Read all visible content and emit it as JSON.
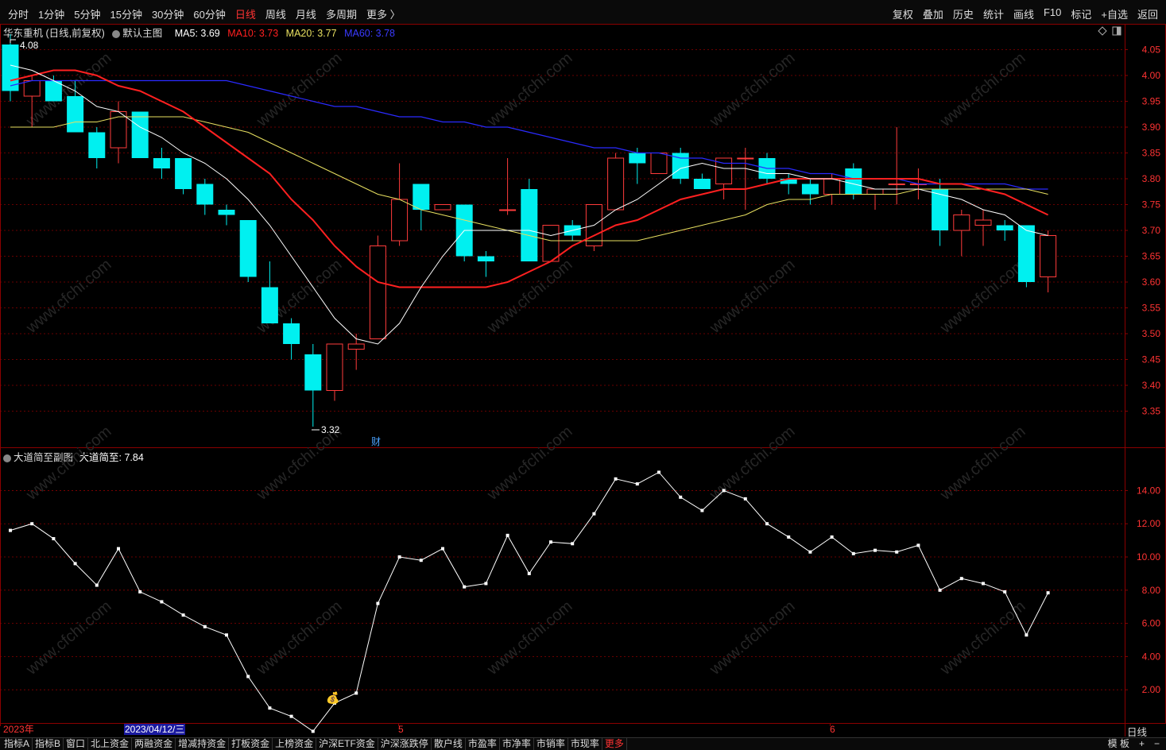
{
  "toolbar": {
    "periods": [
      "分时",
      "1分钟",
      "5分钟",
      "15分钟",
      "30分钟",
      "60分钟",
      "日线",
      "周线",
      "月线",
      "多周期",
      "更多 〉"
    ],
    "active_period": "日线",
    "right_items": [
      "复权",
      "叠加",
      "历史",
      "统计",
      "画线",
      "F10",
      "标记",
      "+自选",
      "返回"
    ]
  },
  "main_legend": {
    "stock": "华东重机 (日线,前复权)",
    "indicator": "默认主图",
    "ma5": "MA5: 3.69",
    "ma10": "MA10: 3.73",
    "ma20": "MA20: 3.77",
    "ma60": "MA60: 3.78"
  },
  "sub_legend": {
    "name": "大道简至副图",
    "value": "大道简至: 7.84"
  },
  "markers": {
    "high": "4.08",
    "low": "3.32",
    "cai": "财",
    "moneybag": "💰"
  },
  "xaxis": {
    "year": "2023年",
    "cursor_date": "2023/04/12/三",
    "month5": "5",
    "month6": "6"
  },
  "period_label": "日线",
  "bottom_tabs": [
    "指标A",
    "指标B",
    "窗口",
    "北上资金",
    "两融资金",
    "增减持资金",
    "打板资金",
    "上榜资金",
    "沪深ETF资金",
    "沪深涨跌停",
    "散户线",
    "市盈率",
    "市净率",
    "市销率",
    "市现率",
    "更多"
  ],
  "bottom_right": [
    "模 板",
    "+",
    "−"
  ],
  "watermark": "www.cfchi.com",
  "colors": {
    "up": "#ff3b3b",
    "down": "#00f0f0",
    "ma5": "#ffffff",
    "ma10": "#ff2020",
    "ma20": "#e8e060",
    "ma60": "#2a2aff",
    "sub": "#ffffff",
    "grid": "#8b0000"
  },
  "chart_data": [
    {
      "type": "candlestick",
      "y_ticks": [
        "4.05",
        "4.00",
        "3.95",
        "3.90",
        "3.85",
        "3.80",
        "3.75",
        "3.70",
        "3.65",
        "3.60",
        "3.55",
        "3.50",
        "3.45",
        "3.40",
        "3.35"
      ],
      "ylim": [
        3.28,
        4.1
      ],
      "candles": [
        {
          "o": 4.06,
          "h": 4.08,
          "l": 3.95,
          "c": 3.97
        },
        {
          "o": 3.96,
          "h": 4.0,
          "l": 3.9,
          "c": 3.99
        },
        {
          "o": 3.99,
          "h": 4.0,
          "l": 3.95,
          "c": 3.95
        },
        {
          "o": 3.96,
          "h": 3.99,
          "l": 3.89,
          "c": 3.89
        },
        {
          "o": 3.89,
          "h": 3.9,
          "l": 3.82,
          "c": 3.84
        },
        {
          "o": 3.86,
          "h": 3.95,
          "l": 3.83,
          "c": 3.93
        },
        {
          "o": 3.93,
          "h": 3.93,
          "l": 3.84,
          "c": 3.84
        },
        {
          "o": 3.84,
          "h": 3.86,
          "l": 3.8,
          "c": 3.82
        },
        {
          "o": 3.84,
          "h": 3.84,
          "l": 3.77,
          "c": 3.78
        },
        {
          "o": 3.79,
          "h": 3.8,
          "l": 3.73,
          "c": 3.75
        },
        {
          "o": 3.74,
          "h": 3.75,
          "l": 3.71,
          "c": 3.73
        },
        {
          "o": 3.72,
          "h": 3.72,
          "l": 3.6,
          "c": 3.61
        },
        {
          "o": 3.59,
          "h": 3.64,
          "l": 3.53,
          "c": 3.52
        },
        {
          "o": 3.52,
          "h": 3.53,
          "l": 3.45,
          "c": 3.48
        },
        {
          "o": 3.46,
          "h": 3.48,
          "l": 3.32,
          "c": 3.39
        },
        {
          "o": 3.39,
          "h": 3.48,
          "l": 3.37,
          "c": 3.48
        },
        {
          "o": 3.47,
          "h": 3.5,
          "l": 3.43,
          "c": 3.48
        },
        {
          "o": 3.49,
          "h": 3.69,
          "l": 3.49,
          "c": 3.67
        },
        {
          "o": 3.68,
          "h": 3.83,
          "l": 3.67,
          "c": 3.76
        },
        {
          "o": 3.79,
          "h": 3.79,
          "l": 3.7,
          "c": 3.74
        },
        {
          "o": 3.74,
          "h": 3.75,
          "l": 3.74,
          "c": 3.75
        },
        {
          "o": 3.75,
          "h": 3.75,
          "l": 3.64,
          "c": 3.65
        },
        {
          "o": 3.65,
          "h": 3.66,
          "l": 3.61,
          "c": 3.64
        },
        {
          "o": 3.74,
          "h": 3.84,
          "l": 3.73,
          "c": 3.74
        },
        {
          "o": 3.78,
          "h": 3.8,
          "l": 3.64,
          "c": 3.64
        },
        {
          "o": 3.64,
          "h": 3.71,
          "l": 3.64,
          "c": 3.71
        },
        {
          "o": 3.71,
          "h": 3.72,
          "l": 3.68,
          "c": 3.69
        },
        {
          "o": 3.67,
          "h": 3.75,
          "l": 3.66,
          "c": 3.75
        },
        {
          "o": 3.74,
          "h": 3.85,
          "l": 3.74,
          "c": 3.84
        },
        {
          "o": 3.85,
          "h": 3.86,
          "l": 3.79,
          "c": 3.83
        },
        {
          "o": 3.81,
          "h": 3.85,
          "l": 3.81,
          "c": 3.85
        },
        {
          "o": 3.85,
          "h": 3.86,
          "l": 3.79,
          "c": 3.8
        },
        {
          "o": 3.8,
          "h": 3.81,
          "l": 3.78,
          "c": 3.78
        },
        {
          "o": 3.79,
          "h": 3.84,
          "l": 3.76,
          "c": 3.84
        },
        {
          "o": 3.84,
          "h": 3.86,
          "l": 3.74,
          "c": 3.84
        },
        {
          "o": 3.84,
          "h": 3.85,
          "l": 3.79,
          "c": 3.8
        },
        {
          "o": 3.8,
          "h": 3.81,
          "l": 3.77,
          "c": 3.79
        },
        {
          "o": 3.79,
          "h": 3.8,
          "l": 3.75,
          "c": 3.77
        },
        {
          "o": 3.77,
          "h": 3.81,
          "l": 3.75,
          "c": 3.8
        },
        {
          "o": 3.82,
          "h": 3.83,
          "l": 3.76,
          "c": 3.77
        },
        {
          "o": 3.77,
          "h": 3.78,
          "l": 3.74,
          "c": 3.78
        },
        {
          "o": 3.79,
          "h": 3.9,
          "l": 3.75,
          "c": 3.79
        },
        {
          "o": 3.79,
          "h": 3.82,
          "l": 3.76,
          "c": 3.79
        },
        {
          "o": 3.78,
          "h": 3.8,
          "l": 3.67,
          "c": 3.7
        },
        {
          "o": 3.7,
          "h": 3.74,
          "l": 3.65,
          "c": 3.73
        },
        {
          "o": 3.71,
          "h": 3.74,
          "l": 3.67,
          "c": 3.72
        },
        {
          "o": 3.71,
          "h": 3.72,
          "l": 3.68,
          "c": 3.7
        },
        {
          "o": 3.71,
          "h": 3.71,
          "l": 3.59,
          "c": 3.6
        },
        {
          "o": 3.61,
          "h": 3.7,
          "l": 3.58,
          "c": 3.69
        }
      ],
      "ma5": [
        4.02,
        4.01,
        3.99,
        3.97,
        3.94,
        3.93,
        3.9,
        3.88,
        3.85,
        3.83,
        3.8,
        3.76,
        3.71,
        3.65,
        3.59,
        3.53,
        3.49,
        3.48,
        3.52,
        3.59,
        3.65,
        3.7,
        3.7,
        3.7,
        3.7,
        3.69,
        3.7,
        3.71,
        3.74,
        3.76,
        3.79,
        3.82,
        3.83,
        3.82,
        3.82,
        3.81,
        3.81,
        3.8,
        3.8,
        3.79,
        3.78,
        3.78,
        3.78,
        3.77,
        3.76,
        3.74,
        3.73,
        3.7,
        3.69
      ],
      "ma10": [
        3.99,
        4.0,
        4.01,
        4.01,
        4.0,
        3.98,
        3.97,
        3.95,
        3.93,
        3.9,
        3.87,
        3.84,
        3.81,
        3.76,
        3.72,
        3.67,
        3.63,
        3.6,
        3.59,
        3.59,
        3.59,
        3.59,
        3.59,
        3.6,
        3.62,
        3.64,
        3.67,
        3.69,
        3.71,
        3.72,
        3.74,
        3.76,
        3.77,
        3.78,
        3.78,
        3.79,
        3.8,
        3.8,
        3.8,
        3.8,
        3.8,
        3.8,
        3.8,
        3.79,
        3.79,
        3.78,
        3.77,
        3.75,
        3.73
      ],
      "ma20": [
        3.9,
        3.9,
        3.9,
        3.91,
        3.91,
        3.92,
        3.92,
        3.92,
        3.92,
        3.91,
        3.9,
        3.89,
        3.87,
        3.85,
        3.83,
        3.81,
        3.79,
        3.77,
        3.76,
        3.74,
        3.73,
        3.72,
        3.71,
        3.7,
        3.69,
        3.68,
        3.68,
        3.68,
        3.68,
        3.68,
        3.69,
        3.7,
        3.71,
        3.72,
        3.73,
        3.75,
        3.76,
        3.76,
        3.77,
        3.77,
        3.77,
        3.77,
        3.78,
        3.78,
        3.78,
        3.78,
        3.78,
        3.78,
        3.77
      ],
      "ma60": [
        3.98,
        3.99,
        3.99,
        3.99,
        3.99,
        3.99,
        3.99,
        3.99,
        3.99,
        3.99,
        3.99,
        3.98,
        3.97,
        3.96,
        3.95,
        3.94,
        3.94,
        3.93,
        3.92,
        3.92,
        3.91,
        3.91,
        3.9,
        3.9,
        3.89,
        3.88,
        3.87,
        3.86,
        3.86,
        3.85,
        3.85,
        3.84,
        3.84,
        3.83,
        3.83,
        3.82,
        3.82,
        3.81,
        3.81,
        3.8,
        3.8,
        3.8,
        3.79,
        3.79,
        3.79,
        3.79,
        3.79,
        3.78,
        3.78
      ]
    },
    {
      "type": "line",
      "y_ticks": [
        "14.00",
        "12.00",
        "10.00",
        "8.00",
        "6.00",
        "4.00",
        "2.00"
      ],
      "ylim": [
        0,
        15.6
      ],
      "values": [
        11.6,
        12.0,
        11.1,
        9.6,
        8.3,
        10.5,
        7.9,
        7.3,
        6.5,
        5.8,
        5.3,
        2.8,
        0.9,
        0.4,
        -0.5,
        1.2,
        1.8,
        7.2,
        10.0,
        9.8,
        10.5,
        8.2,
        8.4,
        11.3,
        9.0,
        10.9,
        10.8,
        12.6,
        14.7,
        14.4,
        15.1,
        13.6,
        12.8,
        14.0,
        13.5,
        12.0,
        11.2,
        10.3,
        11.2,
        10.2,
        10.4,
        10.3,
        10.7,
        8.0,
        8.7,
        8.4,
        7.9,
        5.3,
        7.84
      ],
      "markers": [
        0,
        1,
        2,
        4,
        6,
        8,
        10,
        12,
        14,
        16,
        18,
        20,
        22,
        24,
        26,
        28,
        30,
        32,
        34,
        36,
        38,
        40,
        42,
        44,
        46,
        48
      ]
    }
  ]
}
